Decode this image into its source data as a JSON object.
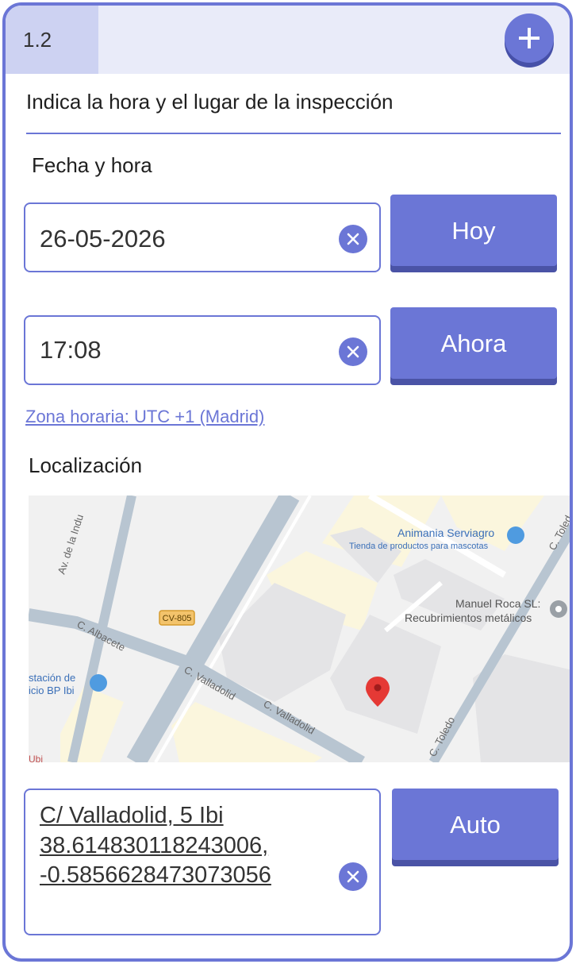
{
  "header": {
    "step": "1.2",
    "add_icon": "plus-icon"
  },
  "instruction": "Indica la hora y el lugar de la inspección",
  "datetime": {
    "section_title": "Fecha y hora",
    "date_value": "26-05-2026",
    "date_button": "Hoy",
    "time_value": "17:08",
    "time_button": "Ahora",
    "timezone_link": "Zona horaria: UTC +1 (Madrid)"
  },
  "location": {
    "section_title": "Localización",
    "map": {
      "labels": {
        "road_1": "Av. de la Indu",
        "road_2": "C. Albacete",
        "road_3": "C. Valladolid",
        "road_4": "C. Valladolid",
        "road_5": "C. Toledo",
        "road_6": "C. Toled",
        "highway": "CV-805",
        "poi_1_name": "Animania Serviagro",
        "poi_1_desc": "Tienda de productos para mascotas",
        "poi_2_name": "Manuel Roca SL:",
        "poi_2_desc": "Recubrimientos metálicos",
        "poi_3_line1": "stación de",
        "poi_3_line2": "icio BP Ibi",
        "poi_4": "Ubi"
      }
    },
    "address_lines": [
      "C/ Valladolid, 5 Ibi",
      "38.614830118243006,",
      "-0.5856628473073056"
    ],
    "auto_button": "Auto"
  },
  "colors": {
    "accent": "#6b76d6",
    "accent_dark": "#4a53a6",
    "header_bg": "#e9ebf9",
    "badge_bg": "#cdd2f2"
  }
}
